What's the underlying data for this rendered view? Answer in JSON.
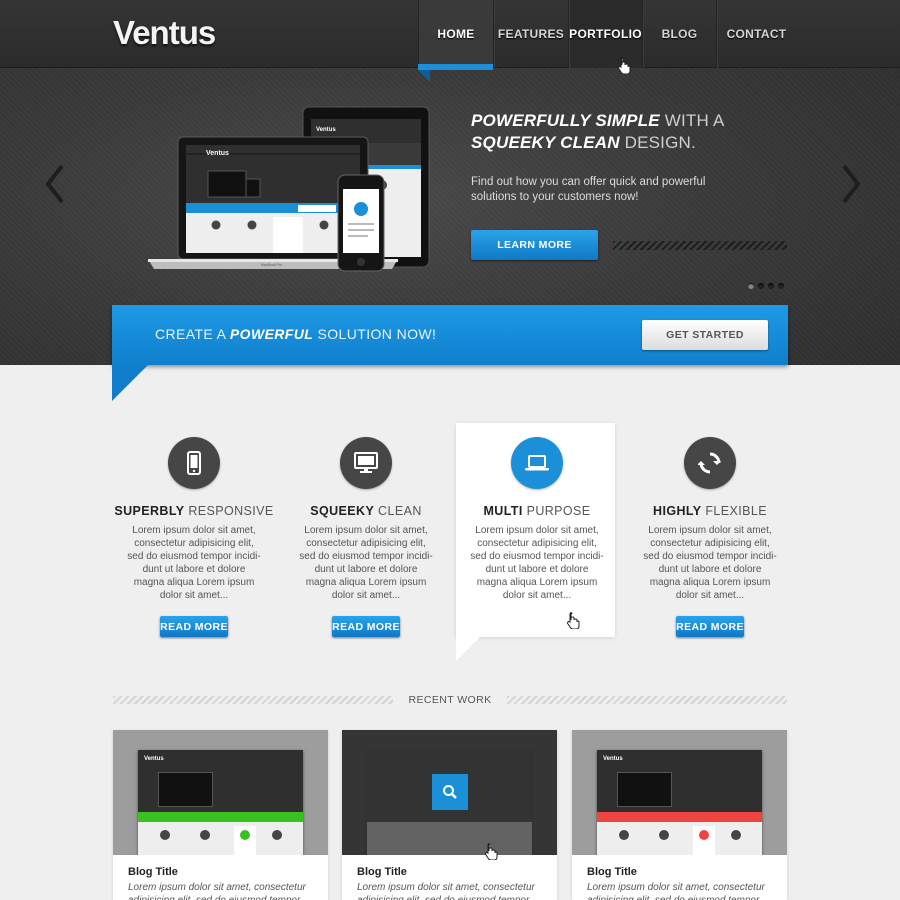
{
  "brand": {
    "logo": "Ventus",
    "accent": "#1b8fd8",
    "dark": "#2f2f2f"
  },
  "nav": {
    "items": [
      {
        "label": "HOME",
        "state": "active"
      },
      {
        "label": "FEATURES",
        "state": "normal"
      },
      {
        "label": "PORTFOLIO",
        "state": "hover"
      },
      {
        "label": "BLOG",
        "state": "normal"
      },
      {
        "label": "CONTACT",
        "state": "normal"
      }
    ]
  },
  "hero": {
    "title_line1_bold": "POWERFULLY SIMPLE",
    "title_line1_rest": " WITH A",
    "title_line2_bold": "SQUEEKY CLEAN",
    "title_line2_rest": " DESIGN.",
    "text": "Find out how you can offer quick and powerful solutions to your customers now!",
    "button": "LEARN MORE",
    "prev_icon": "chevron-left-icon",
    "next_icon": "chevron-right-icon",
    "slide_count": 4,
    "active_slide": 1,
    "device_mock": {
      "logo": "Ventus",
      "laptop_label": "MacBook Pro"
    }
  },
  "cta": {
    "text_pre": "CREATE A ",
    "text_bold": "POWERFUL",
    "text_post": " SOLUTION NOW!",
    "button": "GET STARTED"
  },
  "features": [
    {
      "title_bold": "SUPERBLY",
      "title_rest": " RESPONSIVE",
      "icon": "smartphone-icon",
      "text": "Lorem ipsum dolor sit amet, consectetur adipisicing elit, sed do eiusmod tempor incidi-dunt ut labore et dolore magna aliqua Lorem ipsum dolor sit amet...",
      "button": "READ MORE",
      "highlighted": false
    },
    {
      "title_bold": "SQUEEKY",
      "title_rest": " CLEAN",
      "icon": "monitor-icon",
      "text": "Lorem ipsum dolor sit amet, consectetur adipisicing elit, sed do eiusmod tempor incidi-dunt ut labore et dolore magna aliqua Lorem ipsum dolor sit amet...",
      "button": "READ MORE",
      "highlighted": false
    },
    {
      "title_bold": "MULTI",
      "title_rest": " PURPOSE",
      "icon": "laptop-icon",
      "text": "Lorem ipsum dolor sit amet, consectetur adipisicing elit, sed do eiusmod tempor incidi-dunt ut labore et dolore magna aliqua Lorem ipsum dolor sit amet...",
      "button": "",
      "highlighted": true
    },
    {
      "title_bold": "HIGHLY",
      "title_rest": " FLEXIBLE",
      "icon": "refresh-icon",
      "text": "Lorem ipsum dolor sit amet, consectetur adipisicing elit, sed do eiusmod tempor incidi-dunt ut labore et dolore magna aliqua Lorem ipsum dolor sit amet...",
      "button": "READ MORE",
      "highlighted": false
    }
  ],
  "recent": {
    "label": "RECENT WORK",
    "items": [
      {
        "title": "Blog Title",
        "text": "Lorem ipsum dolor sit amet, consectetur adipisicing elit, sed do eiusmod tempor",
        "accent": "#38c21f",
        "hovered": false
      },
      {
        "title": "Blog Title",
        "text": "Lorem ipsum dolor sit amet, consectetur adipisicing elit, sed do eiusmod tempor",
        "accent": "#1b8fd8",
        "hovered": true,
        "overlay_icon": "search-icon"
      },
      {
        "title": "Blog Title",
        "text": "Lorem ipsum dolor sit amet, consectetur adipisicing elit, sed do eiusmod tempor",
        "accent": "#f0453f",
        "hovered": false
      }
    ]
  }
}
